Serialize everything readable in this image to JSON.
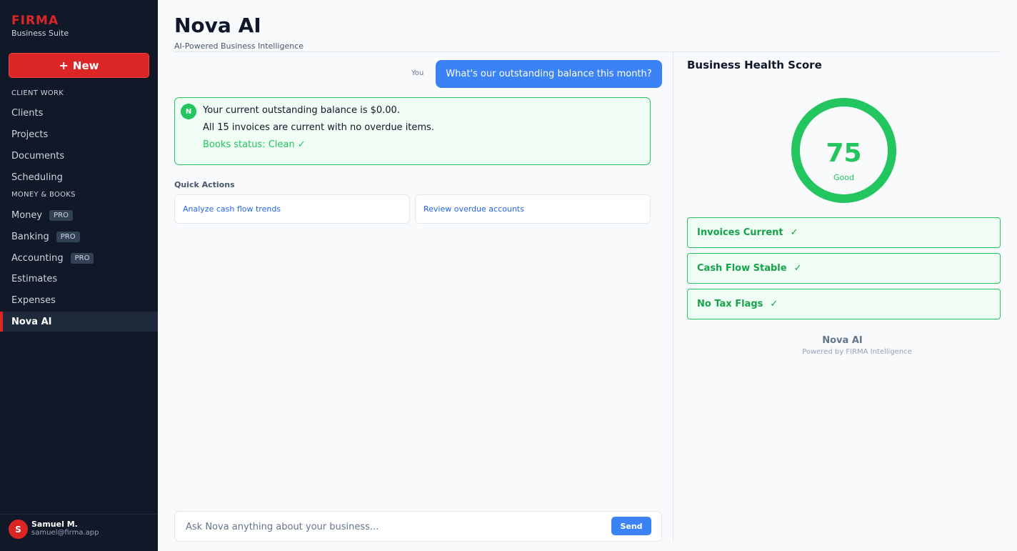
{
  "sidebar": {
    "brand_name": "FIRMA",
    "brand_sub": "Business Suite",
    "new_button": "New",
    "section_client": "CLIENT WORK",
    "section_money": "MONEY & BOOKS",
    "items": [
      {
        "label": "Clients"
      },
      {
        "label": "Projects"
      },
      {
        "label": "Documents"
      },
      {
        "label": "Scheduling"
      },
      {
        "label": "Money",
        "badge": "PRO"
      },
      {
        "label": "Banking",
        "badge": "PRO"
      },
      {
        "label": "Accounting",
        "badge": "PRO"
      },
      {
        "label": "Estimates"
      },
      {
        "label": "Expenses"
      },
      {
        "label": "Nova AI"
      }
    ],
    "user": {
      "initial": "S",
      "name": "Samuel M.",
      "email": "samuel@firma.app"
    }
  },
  "header": {
    "title": "Nova AI",
    "subtitle": "AI-Powered Business Intelligence"
  },
  "chat": {
    "you_label": "You",
    "user_message": "What's our outstanding balance this month?",
    "ai_initial": "N",
    "ai_line1": "Your current outstanding balance is $0.00.",
    "ai_line2": "All 15 invoices are current with no overdue items.",
    "ai_status": "Books status: Clean ✓",
    "quick_actions_title": "Quick Actions",
    "quick_actions": [
      "Analyze cash flow trends",
      "Review overdue accounts"
    ],
    "input_placeholder": "Ask Nova anything about your business...",
    "send_label": "Send"
  },
  "health": {
    "title": "Business Health Score",
    "score": "75",
    "score_label": "Good",
    "cards": [
      {
        "label": "Invoices Current",
        "check": "✓"
      },
      {
        "label": "Cash Flow Stable",
        "check": "✓"
      },
      {
        "label": "No Tax Flags",
        "check": "✓"
      }
    ],
    "footer_name": "Nova AI",
    "footer_sub": "Powered by FIRMA Intelligence"
  },
  "colors": {
    "accent_red": "#dc2626",
    "accent_blue": "#3b82f6",
    "success_green": "#22c55e",
    "sidebar_bg": "#111827"
  }
}
